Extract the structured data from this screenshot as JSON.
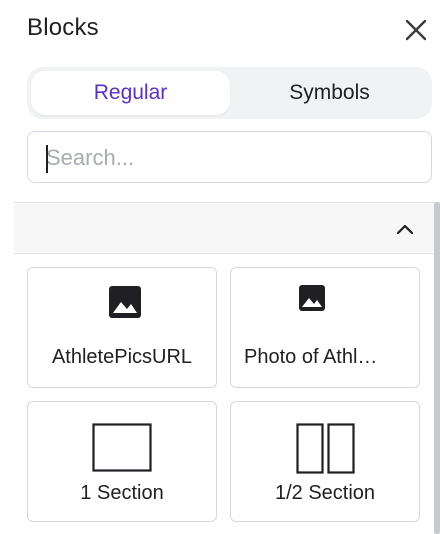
{
  "header": {
    "title": "Blocks",
    "close_icon": "close-icon"
  },
  "tabs": [
    {
      "label": "Regular",
      "active": true
    },
    {
      "label": "Symbols",
      "active": false
    }
  ],
  "search": {
    "placeholder": "Search...",
    "value": ""
  },
  "section": {
    "toggle_icon": "chevron-up-icon",
    "expanded": true
  },
  "blocks": [
    {
      "label": "AthletePicsURL",
      "icon": "image-icon"
    },
    {
      "label": "Photo of Athl…",
      "icon": "image-icon"
    },
    {
      "label": "1 Section",
      "icon": "single-section-icon"
    },
    {
      "label": "1/2 Section",
      "icon": "half-section-icon"
    }
  ],
  "colors": {
    "accent": "#5b2fc9",
    "text": "#1f1f24",
    "border": "#d6d8dd"
  }
}
